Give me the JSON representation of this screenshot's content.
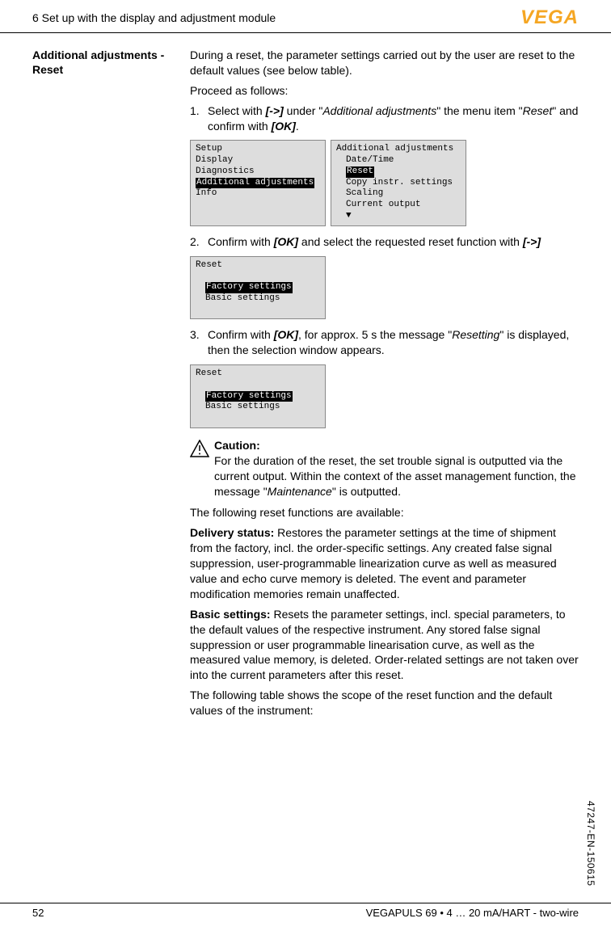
{
  "header": {
    "chapter": "6 Set up with the display and adjustment module",
    "logo": "VEGA"
  },
  "sidebar": {
    "heading": "Additional adjustments - Reset"
  },
  "main": {
    "intro1": "During a reset, the parameter settings carried out by the user are reset to the default values (see below table).",
    "intro2": "Proceed as follows:",
    "step1_pre": "Select with ",
    "step1_key1": "[->]",
    "step1_mid1": " under \"",
    "step1_em1": "Additional adjustments",
    "step1_mid2": "\" the menu item \"",
    "step1_em2": "Reset",
    "step1_mid3": "\" and confirm with ",
    "step1_key2": "[OK]",
    "step1_end": ".",
    "scr1a_l1": "Setup",
    "scr1a_l2": "Display",
    "scr1a_l3": "Diagnostics",
    "scr1a_l4": "Additional adjustments",
    "scr1a_l5": "Info",
    "scr1b_l1": "Additional adjustments",
    "scr1b_l2": "Date/Time",
    "scr1b_l3": "Reset",
    "scr1b_l4": "Copy instr. settings",
    "scr1b_l5": "Scaling",
    "scr1b_l6": "Current output",
    "scr1b_arrow": "▼",
    "step2_pre": "Confirm with ",
    "step2_key1": "[OK]",
    "step2_mid": " and select the requested reset function with ",
    "step2_key2": "[->]",
    "scr2_title": "Reset",
    "scr2_l1": "Factory settings",
    "scr2_l2": "Basic settings",
    "step3_pre": "Confirm with ",
    "step3_key1": "[OK]",
    "step3_mid1": ", for approx. 5 s the message \"",
    "step3_em1": "Resetting",
    "step3_mid2": "\" is displayed, then the selection window appears.",
    "scr3_title": "Reset",
    "scr3_l1": "Factory settings",
    "scr3_l2": "Basic settings",
    "caution_label": "Caution:",
    "caution_text_pre": "For the duration of the reset, the set trouble signal is outputted via the current output. Within the context of the asset management function, the message \"",
    "caution_em": "Maintenance",
    "caution_text_post": "\" is outputted.",
    "functions_intro": "The following reset functions are available:",
    "delivery_label": "Delivery status:",
    "delivery_text": " Restores the parameter settings at the time of shipment from the factory, incl. the order-specific settings. Any created false signal suppression, user-programmable linearization curve as well as measured value and echo curve memory is deleted. The event and parameter modification memories remain unaffected.",
    "basic_label": "Basic settings:",
    "basic_text": " Resets the parameter settings, incl. special parameters, to the default values of the respective instrument. Any stored false signal suppression or user programmable linearisation curve, as well as the measured value memory, is deleted. Order-related settings are not taken over into the current parameters after this reset.",
    "table_intro": "The following table shows the scope of the reset function and the default values of the instrument:"
  },
  "footer": {
    "page_num": "52",
    "product": "VEGAPULS 69 • 4 … 20 mA/HART - two-wire",
    "doc_id": "47247-EN-150615"
  }
}
